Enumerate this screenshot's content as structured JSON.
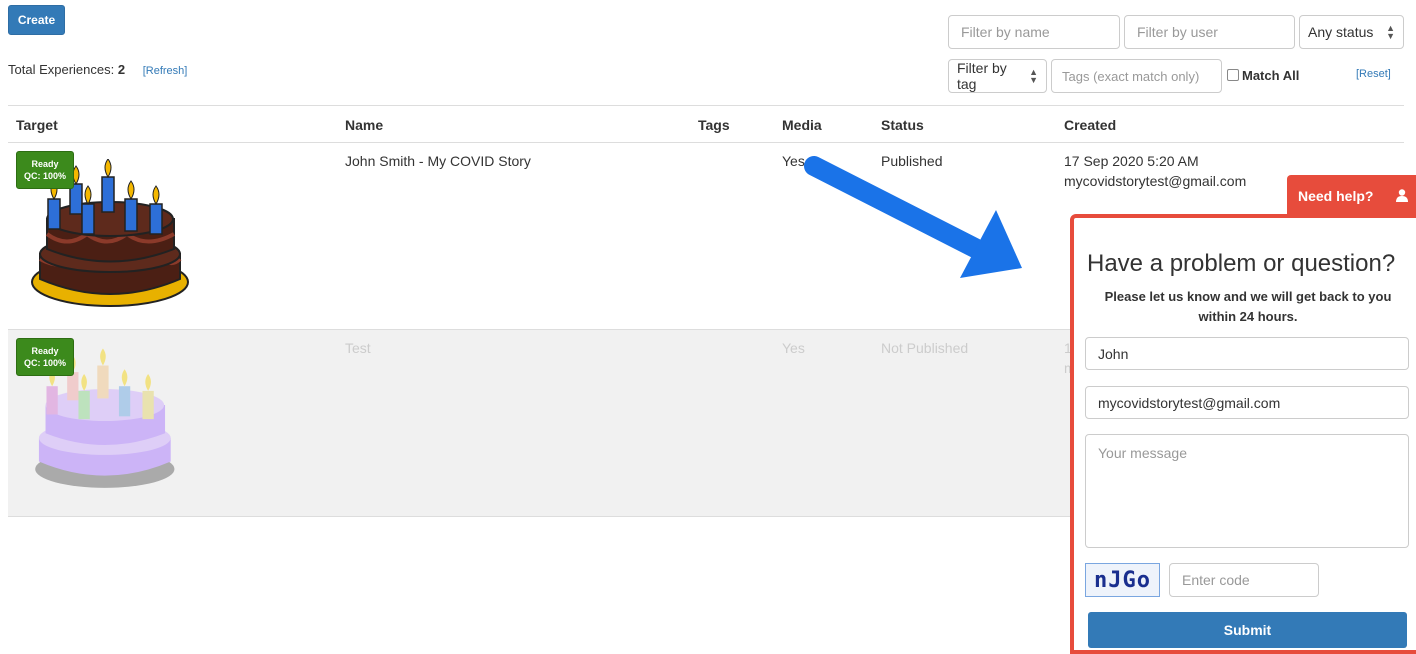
{
  "toolbar": {
    "create_label": "Create",
    "total_label": "Total Experiences:",
    "total_count": "2",
    "refresh_label": "[Refresh]",
    "reset_label": "[Reset]"
  },
  "filters": {
    "name_placeholder": "Filter by name",
    "user_placeholder": "Filter by user",
    "status_value": "Any status",
    "tag_select_value": "Filter by tag",
    "tags_placeholder": "Tags (exact match only)",
    "match_all_label": "Match All"
  },
  "table": {
    "headers": [
      "Target",
      "Name",
      "Tags",
      "Media",
      "Status",
      "Created"
    ],
    "rows": [
      {
        "badge_line1": "Ready",
        "badge_line2": "QC: 100%",
        "name": "John Smith - My COVID Story",
        "tags": "",
        "media": "Yes",
        "status": "Published",
        "created_date": "17 Sep 2020 5:20 AM",
        "created_user": "mycovidstorytest@gmail.com"
      },
      {
        "badge_line1": "Ready",
        "badge_line2": "QC: 100%",
        "name": "Test",
        "tags": "",
        "media": "Yes",
        "status": "Not Published",
        "created_date": "1",
        "created_user": "m"
      }
    ]
  },
  "help": {
    "tab_label": "Need help?",
    "title": "Have a problem or question?",
    "subtitle": "Please let us know and we will get back to you within 24 hours.",
    "name_value": "John",
    "email_value": "mycovidstorytest@gmail.com",
    "message_placeholder": "Your message",
    "captcha_text": "nJGo",
    "code_placeholder": "Enter code",
    "submit_label": "Submit"
  },
  "colors": {
    "primary": "#337ab7",
    "help_red": "#e74c3c",
    "badge_green": "#3c8a1c",
    "arrow_blue": "#1a73e8"
  }
}
